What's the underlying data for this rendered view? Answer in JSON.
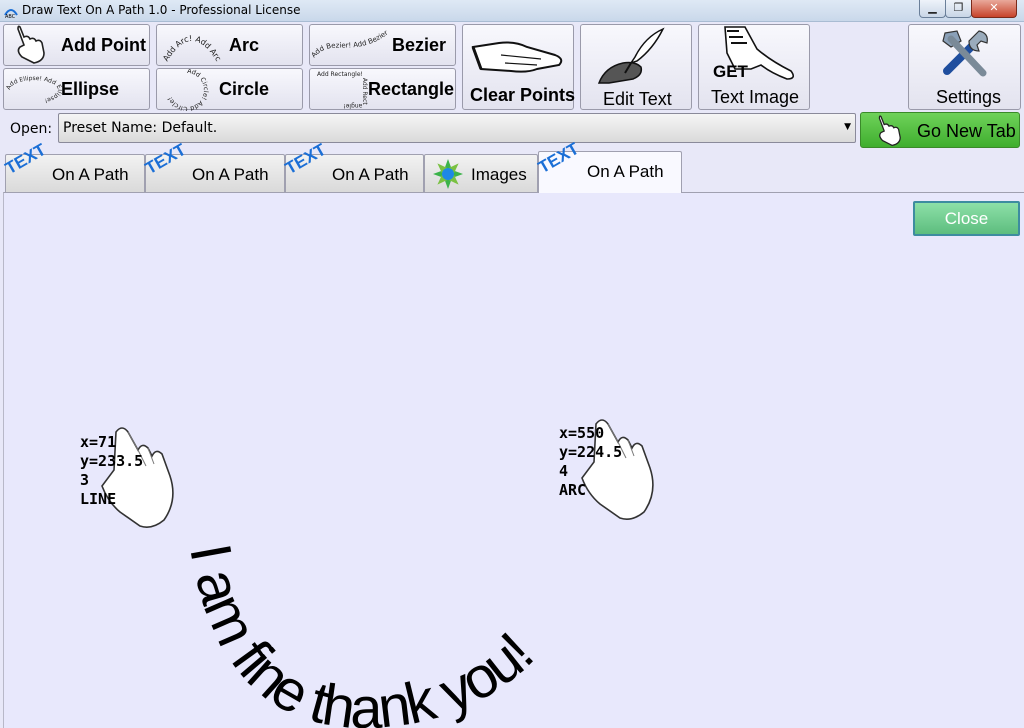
{
  "window": {
    "title": "Draw Text On A Path 1.0 - Professional License",
    "minimize_icon": "minimize-icon",
    "maximize_icon": "maximize-icon",
    "close_icon": "close-icon"
  },
  "toolbar": {
    "add_point": "Add Point",
    "arc": "Arc",
    "bezier": "Bezier",
    "ellipse": "Ellipse",
    "circle": "Circle",
    "rectangle": "Rectangle",
    "clear_points": "Clear Points",
    "edit_text": "Edit Text",
    "get_word": "GET",
    "text_image": "Text Image",
    "settings": "Settings",
    "arc_preview": "Add Arc! Add Arc",
    "bezier_preview": "Add Bezier! Add Bezier!",
    "ellipse_preview": "Add Ellipse! Add Ellipse!",
    "circle_preview": "Add Circle! Add Circle!",
    "rectangle_preview": "Add Rectangle! Add Rectangle!"
  },
  "open": {
    "label": "Open:",
    "value": "Preset Name: Default.",
    "go_new_tab": "Go New Tab"
  },
  "tabs": [
    {
      "icon_text": "TEXT",
      "label": "On A Path"
    },
    {
      "icon_text": "TEXT",
      "label": "On A Path"
    },
    {
      "icon_text": "TEXT",
      "label": "On A Path"
    },
    {
      "icon_text": "",
      "label": "Images"
    },
    {
      "icon_text": "TEXT",
      "label": "On A Path"
    }
  ],
  "canvas": {
    "close": "Close",
    "path_text": "I am fine thank you!",
    "points": [
      {
        "x": "x=71",
        "y": "y=233.5",
        "index": "3",
        "type": "LINE"
      },
      {
        "x": "x=550",
        "y": "y=224.5",
        "index": "4",
        "type": "ARC"
      }
    ]
  },
  "colors": {
    "background": "#e8e8f8",
    "go_button": "#4cbf3a",
    "close_button": "#70cc90",
    "tab_icon_text": "#1b6fd6"
  }
}
